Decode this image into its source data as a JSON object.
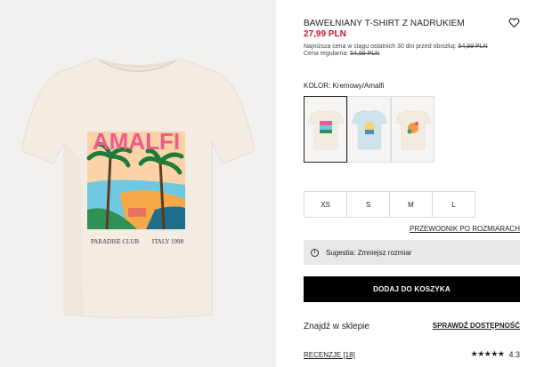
{
  "product": {
    "title": "BAWEŁNIANY T-SHIRT Z NADRUKIEM",
    "price": "27,99 PLN",
    "lowest_price_text": "Najniższa cena w ciągu ostatnich 30 dni przed obniżką:",
    "lowest_price_value": "54,99 PLN",
    "regular_price_text": "Cena regularna:",
    "regular_price_value": "54,99 PLN",
    "favorite_icon": "heart-icon"
  },
  "print": {
    "headline": "AMALFI",
    "left_text": "PARADISE CLUB",
    "right_text": "ITALY 1998"
  },
  "color": {
    "label": "KOLOR:",
    "value": "Kremowy/Amalfi",
    "swatches": [
      {
        "name": "Kremowy/Amalfi",
        "selected": true,
        "shirt_color": "#f3ece3"
      },
      {
        "name": "Jasnoniebieski",
        "selected": false,
        "shirt_color": "#cfe3ea"
      },
      {
        "name": "Kremowy",
        "selected": false,
        "shirt_color": "#f4ebdf"
      }
    ]
  },
  "sizes": [
    "XS",
    "S",
    "M",
    "L"
  ],
  "size_guide_link": "PRZEWODNIK PO ROZMIARACH",
  "suggestion": {
    "icon": "info-icon",
    "text": "Sugestia: Zmniejsz rozmiar"
  },
  "add_to_cart_label": "DODAJ DO KOSZYKA",
  "store": {
    "label": "Znajdź w sklepie",
    "link": "SPRAWDŹ DOSTĘPNOŚĆ"
  },
  "reviews": {
    "link": "RECENZJE [18]",
    "stars_text": "★★★★★",
    "rating": "4.3"
  },
  "colors": {
    "price_red": "#d0112b",
    "button_black": "#000000",
    "image_bg": "#f2f1ef"
  }
}
